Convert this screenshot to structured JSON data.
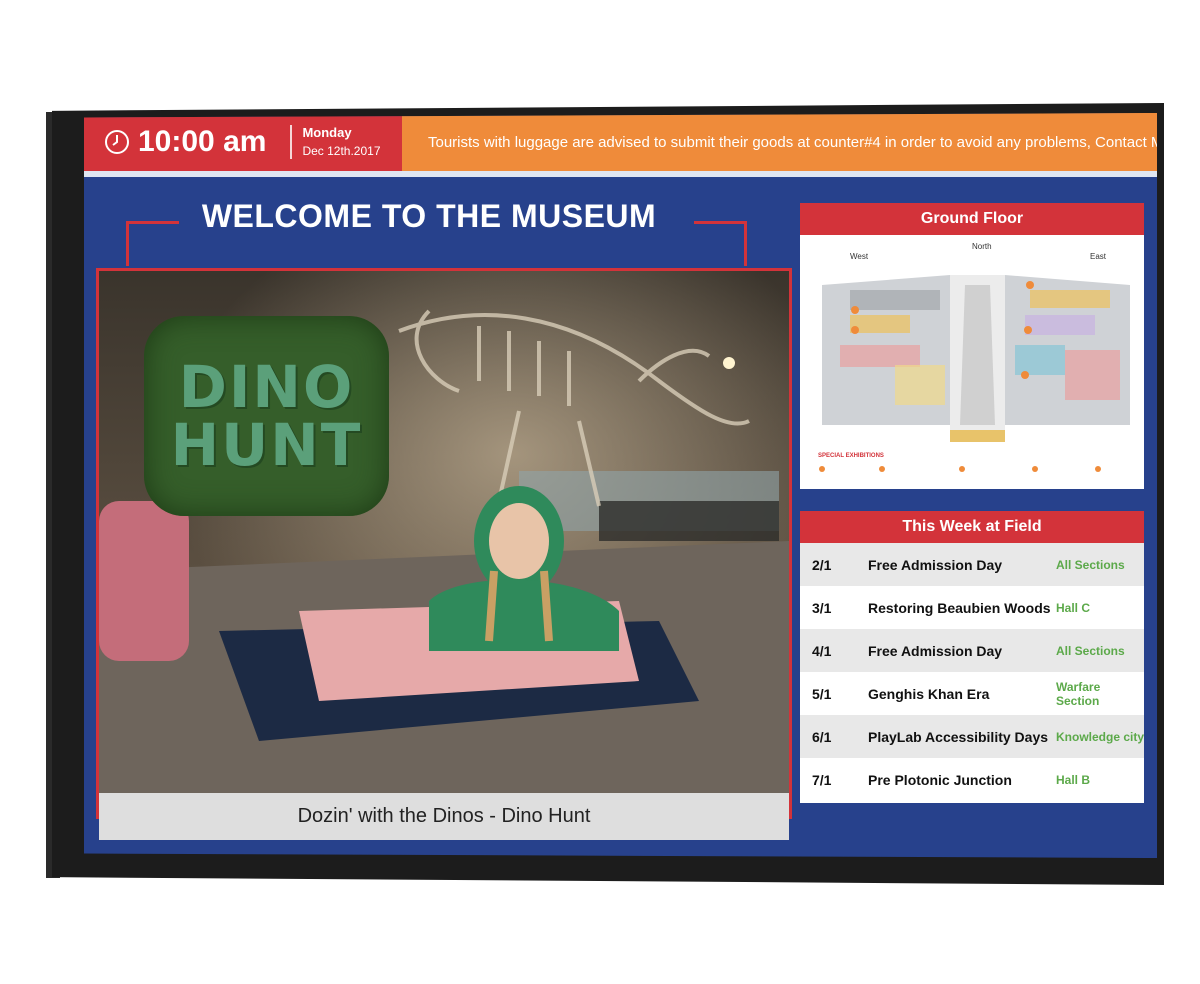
{
  "header": {
    "time": "10:00 am",
    "day": "Monday",
    "date": "Dec 12th.2017",
    "ticker": "Tourists with luggage are advised to submit their goods at counter#4 in order to avoid any problems, Contact Mr.Tom Gilber"
  },
  "main": {
    "welcome": "WELCOME TO THE MUSEUM",
    "sign_line1": "DINO",
    "sign_line2": "HUNT",
    "caption": "Dozin' with the Dinos - Dino Hunt"
  },
  "map": {
    "title": "Ground Floor",
    "west": "West",
    "north": "North",
    "east": "East",
    "special": "SPECIAL EXHIBITIONS"
  },
  "schedule": {
    "title": "This Week at Field",
    "rows": [
      {
        "date": "2/1",
        "event": "Free Admission Day",
        "location": "All Sections"
      },
      {
        "date": "3/1",
        "event": "Restoring Beaubien Woods",
        "location": "Hall C"
      },
      {
        "date": "4/1",
        "event": "Free Admission Day",
        "location": "All Sections"
      },
      {
        "date": "5/1",
        "event": "Genghis Khan Era",
        "location": "Warfare Section"
      },
      {
        "date": "6/1",
        "event": "PlayLab Accessibility Days",
        "location": "Knowledge city"
      },
      {
        "date": "7/1",
        "event": "Pre Plotonic Junction",
        "location": "Hall B"
      }
    ]
  },
  "colors": {
    "accent_red": "#d3333a",
    "ticker_orange": "#ef8b3a",
    "screen_blue": "#27418c",
    "location_green": "#5ca94a"
  }
}
